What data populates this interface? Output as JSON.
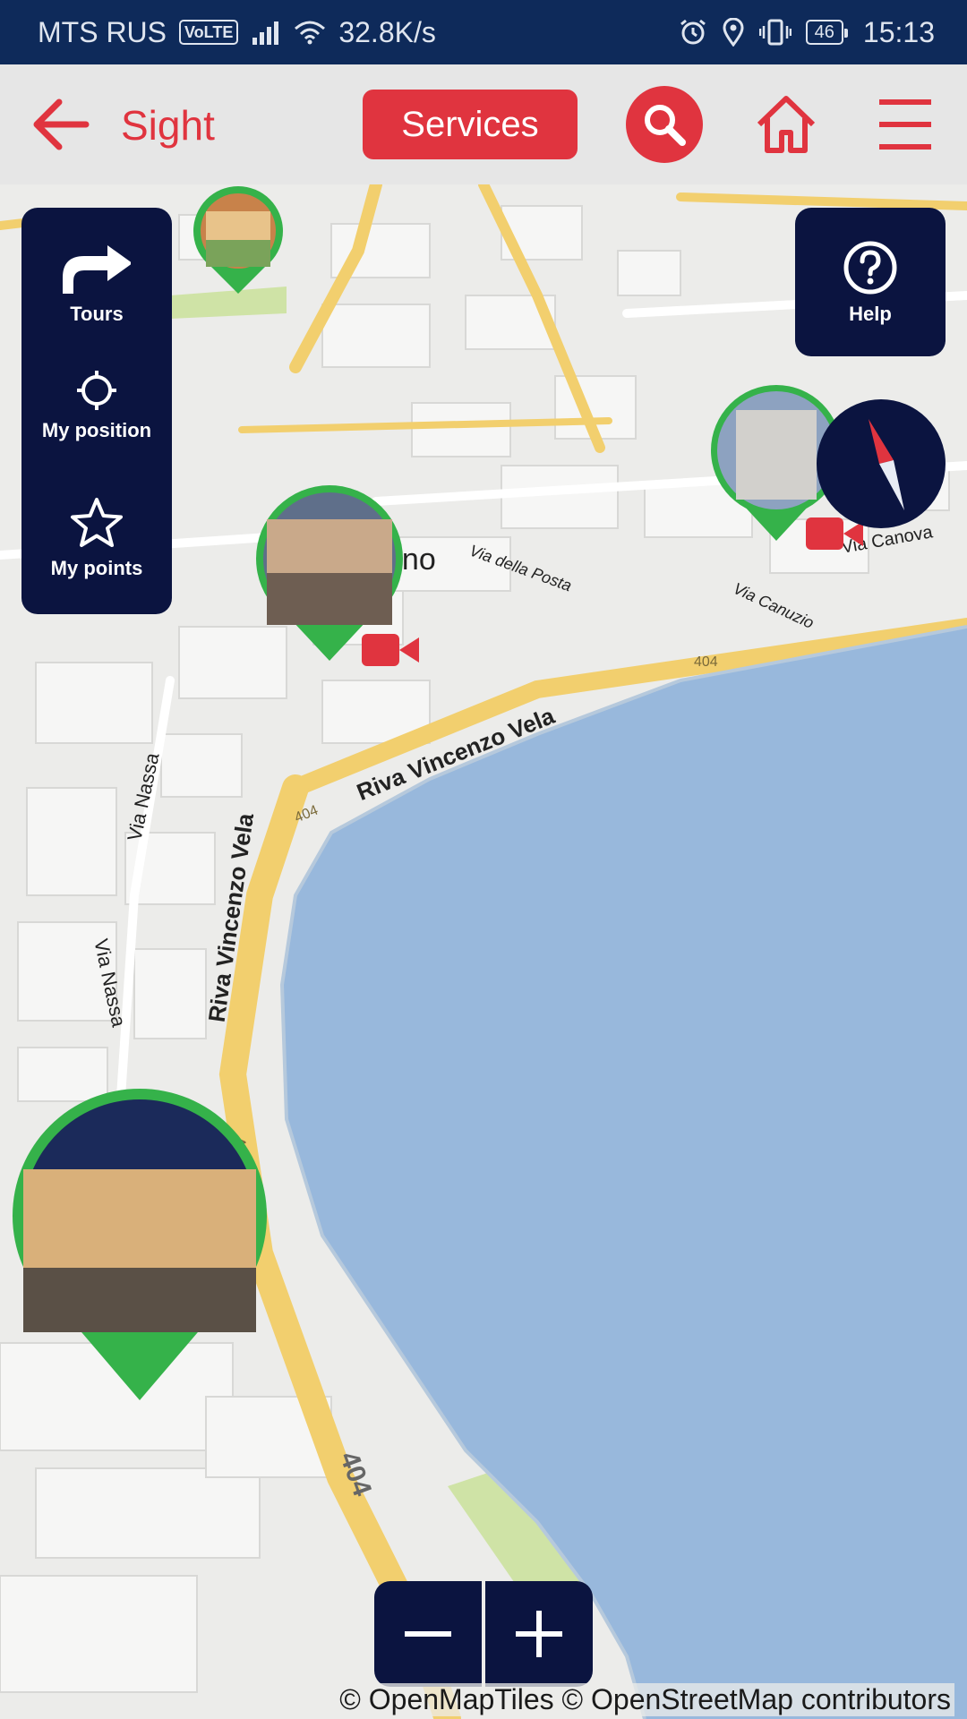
{
  "status_bar": {
    "carrier": "MTS RUS",
    "volte": "VoLTE",
    "speed": "32.8K/s",
    "battery": "46",
    "time": "15:13"
  },
  "app_bar": {
    "title": "Sight",
    "services_label": "Services",
    "icons": [
      "arrow-left-icon",
      "search-icon",
      "home-icon",
      "hamburger-menu-icon"
    ]
  },
  "left_panel": {
    "items": [
      {
        "label": "Tours",
        "icon": "route-turn-icon"
      },
      {
        "label": "My position",
        "icon": "crosshair-icon"
      },
      {
        "label": "My points",
        "icon": "star-icon"
      }
    ]
  },
  "help": {
    "label": "Help",
    "icon": "question-circle-icon"
  },
  "map": {
    "labels": [
      {
        "text": "Riva Vincenzo Vela"
      },
      {
        "text": "Riva Vincenzo Vela"
      },
      {
        "text": "Via Nassa"
      },
      {
        "text": "Via Nassa"
      },
      {
        "text": "Via della Posta"
      },
      {
        "text": "Via Canuzio"
      },
      {
        "text": "Via Canova"
      },
      {
        "text": "ano"
      },
      {
        "text": "404"
      },
      {
        "text": "404"
      },
      {
        "text": "404"
      },
      {
        "text": "404"
      }
    ],
    "colors": {
      "water": "#98b8dc",
      "land": "#ececea",
      "road": "#f2cf6e",
      "marker": "#35b24a",
      "accent": "#e0343f",
      "panel": "#0b1440"
    }
  },
  "zoom": {
    "minus_icon": "minus-icon",
    "plus_icon": "plus-icon"
  },
  "attribution": "© OpenMapTiles © OpenStreetMap contributors"
}
